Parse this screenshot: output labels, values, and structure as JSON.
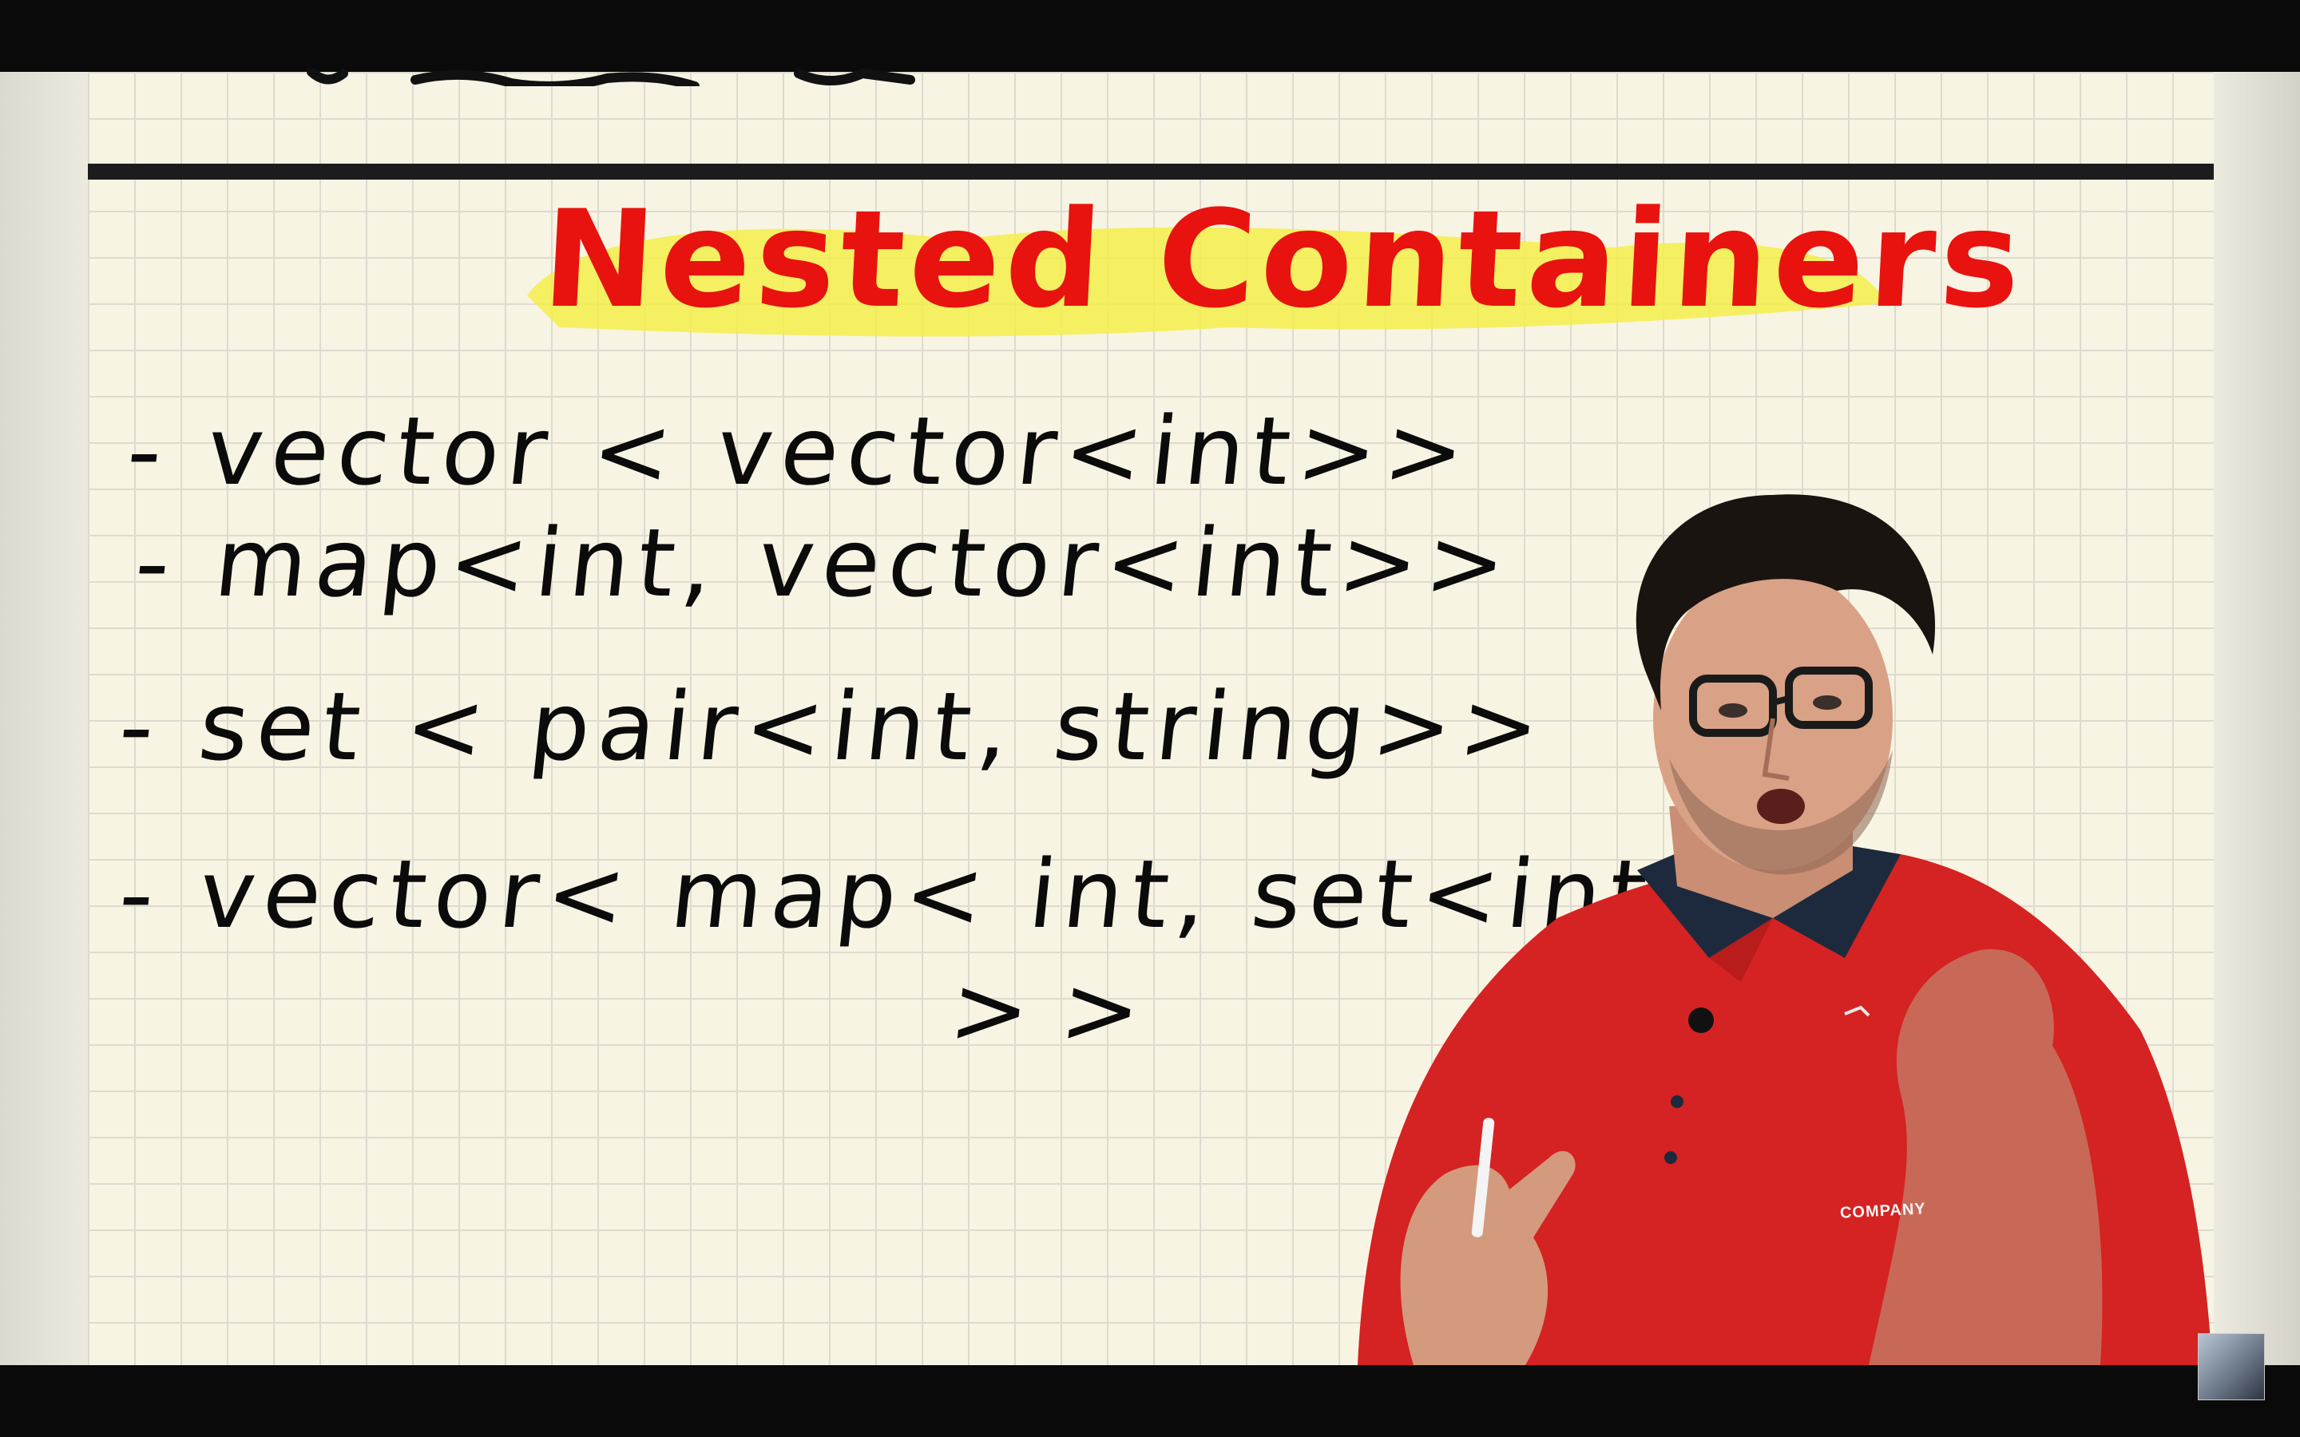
{
  "video": {
    "title": "Nested Containers",
    "lines": [
      "- vector < vector<int>>",
      "- map<int, vector<int>>",
      "- set < pair<int, string>>",
      "- vector< map< int, set<int>",
      ">>"
    ],
    "shirt_logo": "COMPANY"
  },
  "colors": {
    "title_ink": "#e8120f",
    "highlighter": "#f3ee4a",
    "ink": "#0b0b0b",
    "paper": "#f8f4e3",
    "shirt": "#d42322"
  },
  "icons": {
    "corner": "channel-avatar-icon"
  }
}
